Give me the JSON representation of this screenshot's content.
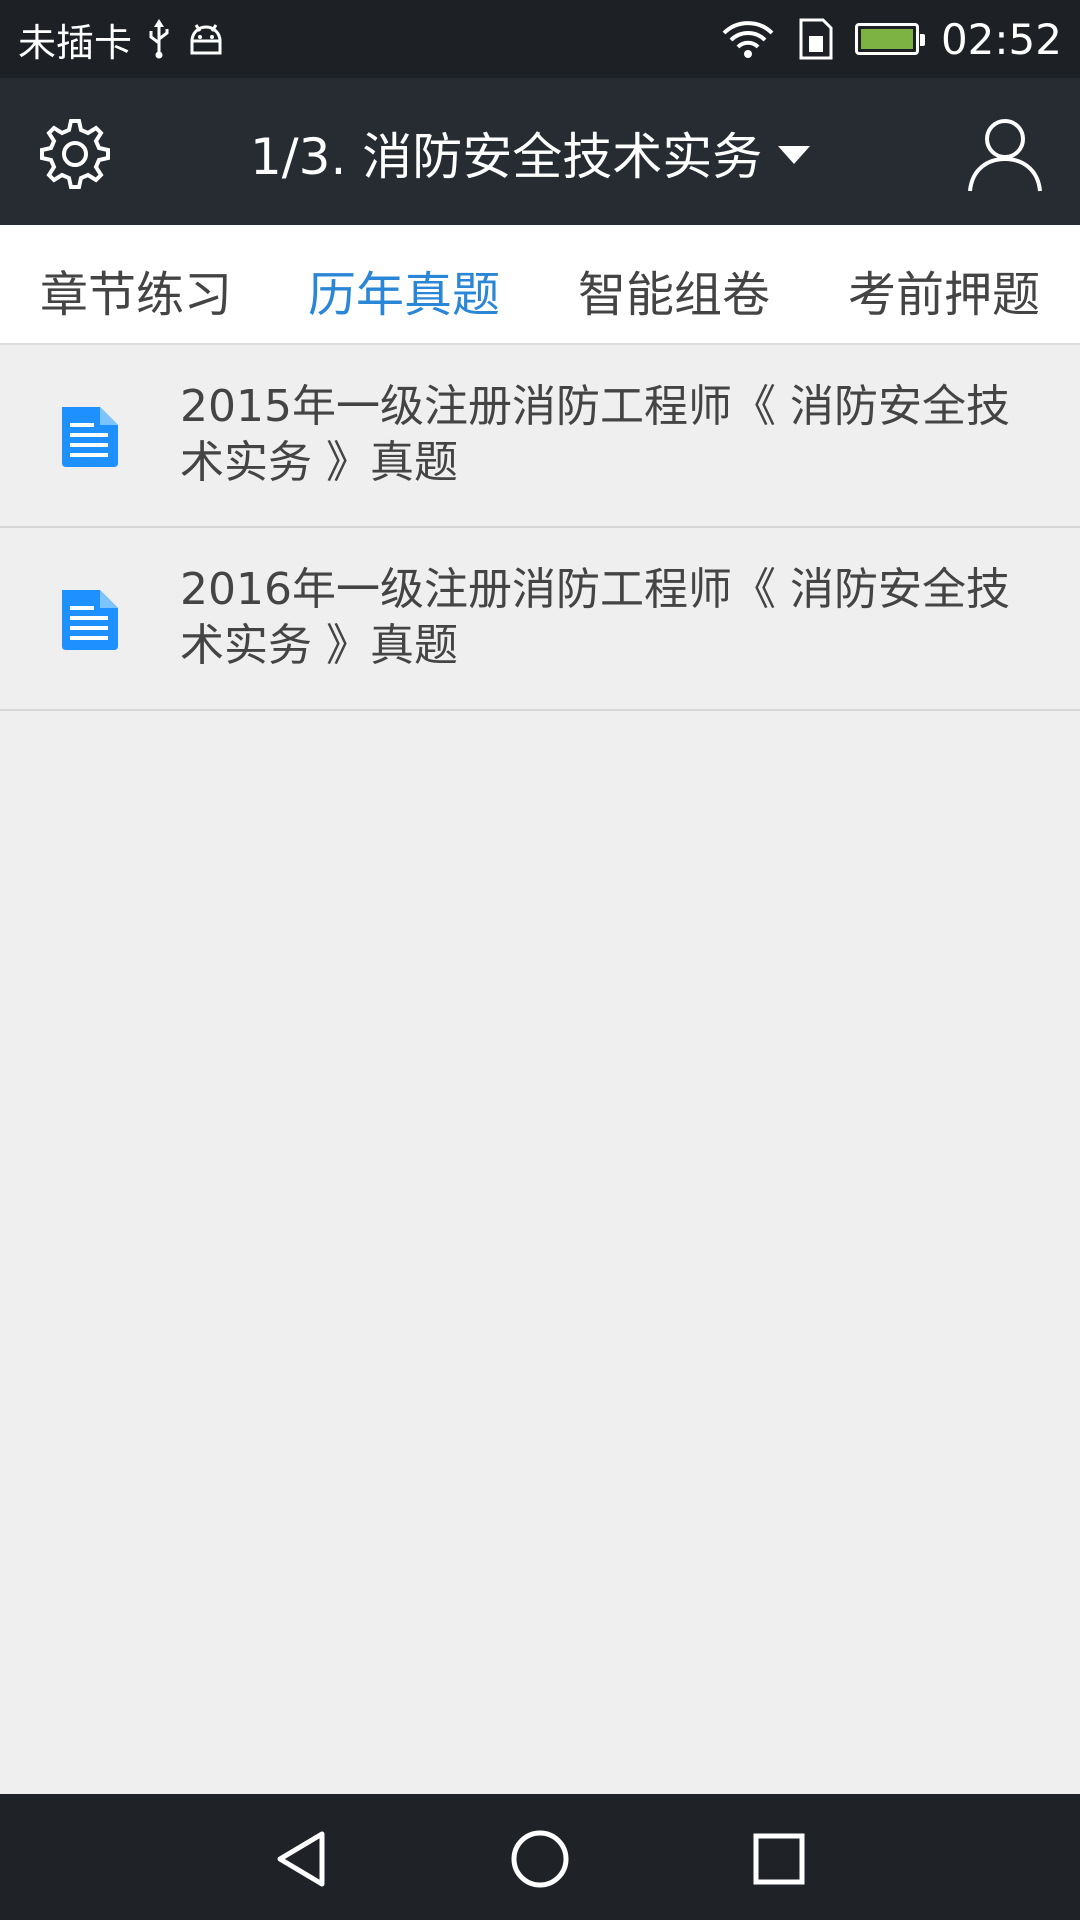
{
  "status_bar": {
    "carrier": "未插卡",
    "time": "02:52",
    "icons": [
      "usb-icon",
      "android-debug-icon",
      "wifi-icon",
      "sim-icon",
      "battery-charging-icon"
    ],
    "battery_color": "#7cb342"
  },
  "app_bar": {
    "title": "1/3. 消防安全技术实务",
    "settings_icon": "gear-icon",
    "profile_icon": "user-icon"
  },
  "tabs": [
    {
      "label": "章节练习",
      "active": false
    },
    {
      "label": "历年真题",
      "active": true
    },
    {
      "label": "智能组卷",
      "active": false
    },
    {
      "label": "考前押题",
      "active": false
    }
  ],
  "colors": {
    "accent": "#2a87d8",
    "appbar_bg": "#272c33",
    "page_bg": "#efefef"
  },
  "list": [
    {
      "title": "2015年一级注册消防工程师《 消防安全技术实务 》真题",
      "icon": "document-icon"
    },
    {
      "title": "2016年一级注册消防工程师《 消防安全技术实务 》真题",
      "icon": "document-icon"
    }
  ],
  "nav_bar": {
    "buttons": [
      "back-icon",
      "home-icon",
      "recents-icon"
    ]
  }
}
